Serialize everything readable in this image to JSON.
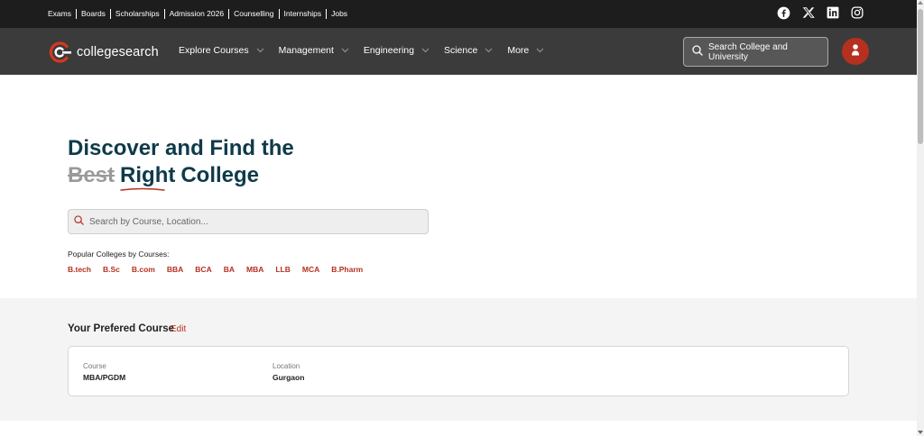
{
  "topbar": {
    "links": [
      "Exams",
      "Boards",
      "Scholarships",
      "Admission 2026",
      "Counselling",
      "Internships",
      "Jobs"
    ],
    "social_icons": [
      "facebook-icon",
      "x-icon",
      "linkedin-icon",
      "instagram-icon"
    ]
  },
  "nav": {
    "logo_text": "collegesearch",
    "items": [
      "Explore Courses",
      "Management",
      "Engineering",
      "Science",
      "More"
    ],
    "search_label": "Search College and University"
  },
  "hero": {
    "title_line1": "Discover and Find the",
    "title_strike": "Best",
    "title_accent": "Right",
    "title_end": "College",
    "search_placeholder": "Search by Course, Location...",
    "popular_label": "Popular Colleges by Courses:",
    "chips": [
      "B.tech",
      "B.Sc",
      "B.com",
      "BBA",
      "BCA",
      "BA",
      "MBA",
      "LLB",
      "MCA",
      "B.Pharm"
    ]
  },
  "preferred": {
    "title": "Your Prefered Course",
    "edit_label": "Edit",
    "course_label": "Course",
    "course_value": "MBA/PGDM",
    "location_label": "Location",
    "location_value": "Gurgaon"
  },
  "colors": {
    "topbar_bg": "#1d1d1d",
    "nav_bg": "#3b3b3b",
    "accent": "#b5301f",
    "heading": "#0f3a4a"
  }
}
